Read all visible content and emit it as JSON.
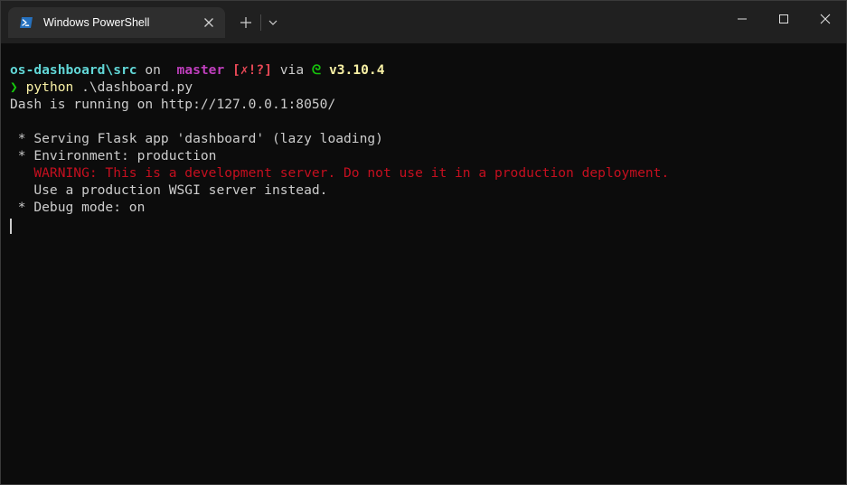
{
  "window": {
    "tab_title": "Windows PowerShell",
    "tab_icon": "powershell-icon",
    "new_tab_symbol": "+",
    "colors": {
      "titlebar": "#202020",
      "active_tab": "#2e2e2e",
      "terminal_bg": "#0c0c0c",
      "text": "#cccccc"
    }
  },
  "prompt": {
    "path": "os-dashboard\\src",
    "on": " on ",
    "branch_icon": "",
    "branch": " master",
    "status": " [✗!?]",
    "via": " via ",
    "python_icon": "ᘓ",
    "python_version": " v3.10.4",
    "chevron": "❯",
    "command": " python",
    "command_args": " .\\dashboard.py"
  },
  "output": {
    "line_dash": "Dash is running on http://127.0.0.1:8050/",
    "line_serving": " * Serving Flask app 'dashboard' (lazy loading)",
    "line_environment": " * Environment: production",
    "line_warning": "   WARNING: This is a development server. Do not use it in a production deployment.",
    "line_wsgi": "   Use a production WSGI server instead.",
    "line_debug": " * Debug mode: on"
  }
}
